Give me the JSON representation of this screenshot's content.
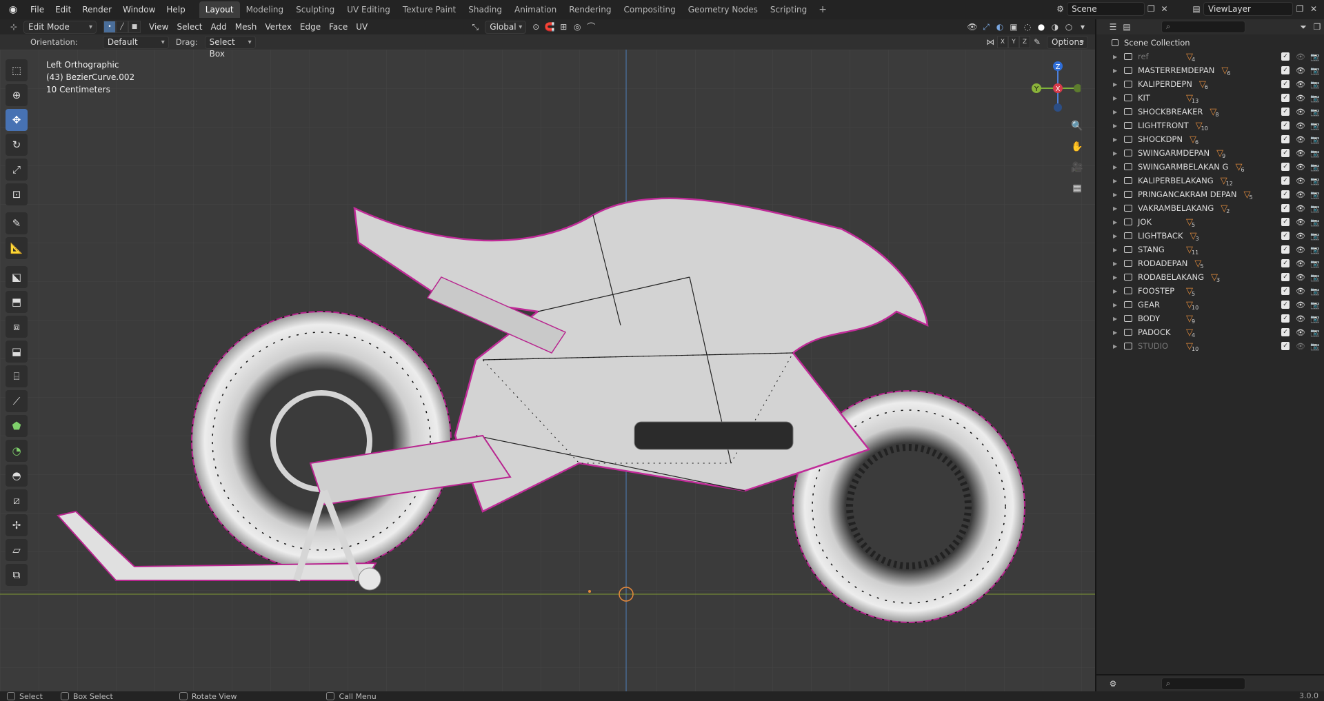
{
  "topbar": {
    "menus": [
      "File",
      "Edit",
      "Render",
      "Window",
      "Help"
    ],
    "workspaces": [
      "Layout",
      "Modeling",
      "Sculpting",
      "UV Editing",
      "Texture Paint",
      "Shading",
      "Animation",
      "Rendering",
      "Compositing",
      "Geometry Nodes",
      "Scripting"
    ],
    "active_workspace": "Layout",
    "scene": "Scene",
    "view_layer": "ViewLayer"
  },
  "viewport": {
    "mode": "Edit Mode",
    "menus": [
      "View",
      "Select",
      "Add",
      "Mesh",
      "Vertex",
      "Edge",
      "Face",
      "UV"
    ],
    "transform_orientation": "Global",
    "orientation_label": "Orientation:",
    "orientation_value": "Default",
    "drag_label": "Drag:",
    "drag_value": "Select Box",
    "options_label": "Options",
    "axis_labels": [
      "X",
      "Y",
      "Z"
    ],
    "info_line1": "Left Orthographic",
    "info_line2": "(43) BezierCurve.002",
    "info_line3": "10 Centimeters",
    "gizmo_axes": {
      "z": "Z",
      "y": "Y",
      "x": "X"
    }
  },
  "outliner": {
    "root": "Scene Collection",
    "collections": [
      {
        "name": "ref",
        "count": "4",
        "dim": true
      },
      {
        "name": "MASTERREMDEPAN",
        "count": "6",
        "dim": false
      },
      {
        "name": "KALIPERDEPN",
        "count": "6",
        "dim": false
      },
      {
        "name": "KIT",
        "count": "13",
        "dim": false
      },
      {
        "name": "SHOCKBREAKER",
        "count": "8",
        "dim": false
      },
      {
        "name": "LIGHTFRONT",
        "count": "10",
        "dim": false
      },
      {
        "name": "SHOCKDPN",
        "count": "6",
        "dim": false
      },
      {
        "name": "SWINGARMDEPAN",
        "count": "9",
        "dim": false
      },
      {
        "name": "SWINGARMBELAKAN G",
        "count": "6",
        "dim": false
      },
      {
        "name": "KALIPERBELAKANG",
        "count": "12",
        "dim": false
      },
      {
        "name": "PRINGANCAKRAM DEPAN",
        "count": "5",
        "dim": false
      },
      {
        "name": "VAKRAMBELAKANG",
        "count": "2",
        "dim": false
      },
      {
        "name": "JOK",
        "count": "5",
        "dim": false
      },
      {
        "name": "LIGHTBACK",
        "count": "3",
        "dim": false
      },
      {
        "name": "STANG",
        "count": "11",
        "dim": false
      },
      {
        "name": "RODADEPAN",
        "count": "5",
        "dim": false
      },
      {
        "name": "RODABELAKANG",
        "count": "3",
        "dim": false
      },
      {
        "name": "FOOSTEP",
        "count": "5",
        "dim": false
      },
      {
        "name": "GEAR",
        "count": "10",
        "dim": false
      },
      {
        "name": "BODY",
        "count": "9",
        "dim": false
      },
      {
        "name": "PADOCK",
        "count": "4",
        "dim": false
      },
      {
        "name": "STUDIO",
        "count": "10",
        "dim": true
      }
    ]
  },
  "statusbar": {
    "items": [
      "Select",
      "Box Select",
      "Rotate View",
      "Call Menu"
    ],
    "version": "3.0.0"
  }
}
